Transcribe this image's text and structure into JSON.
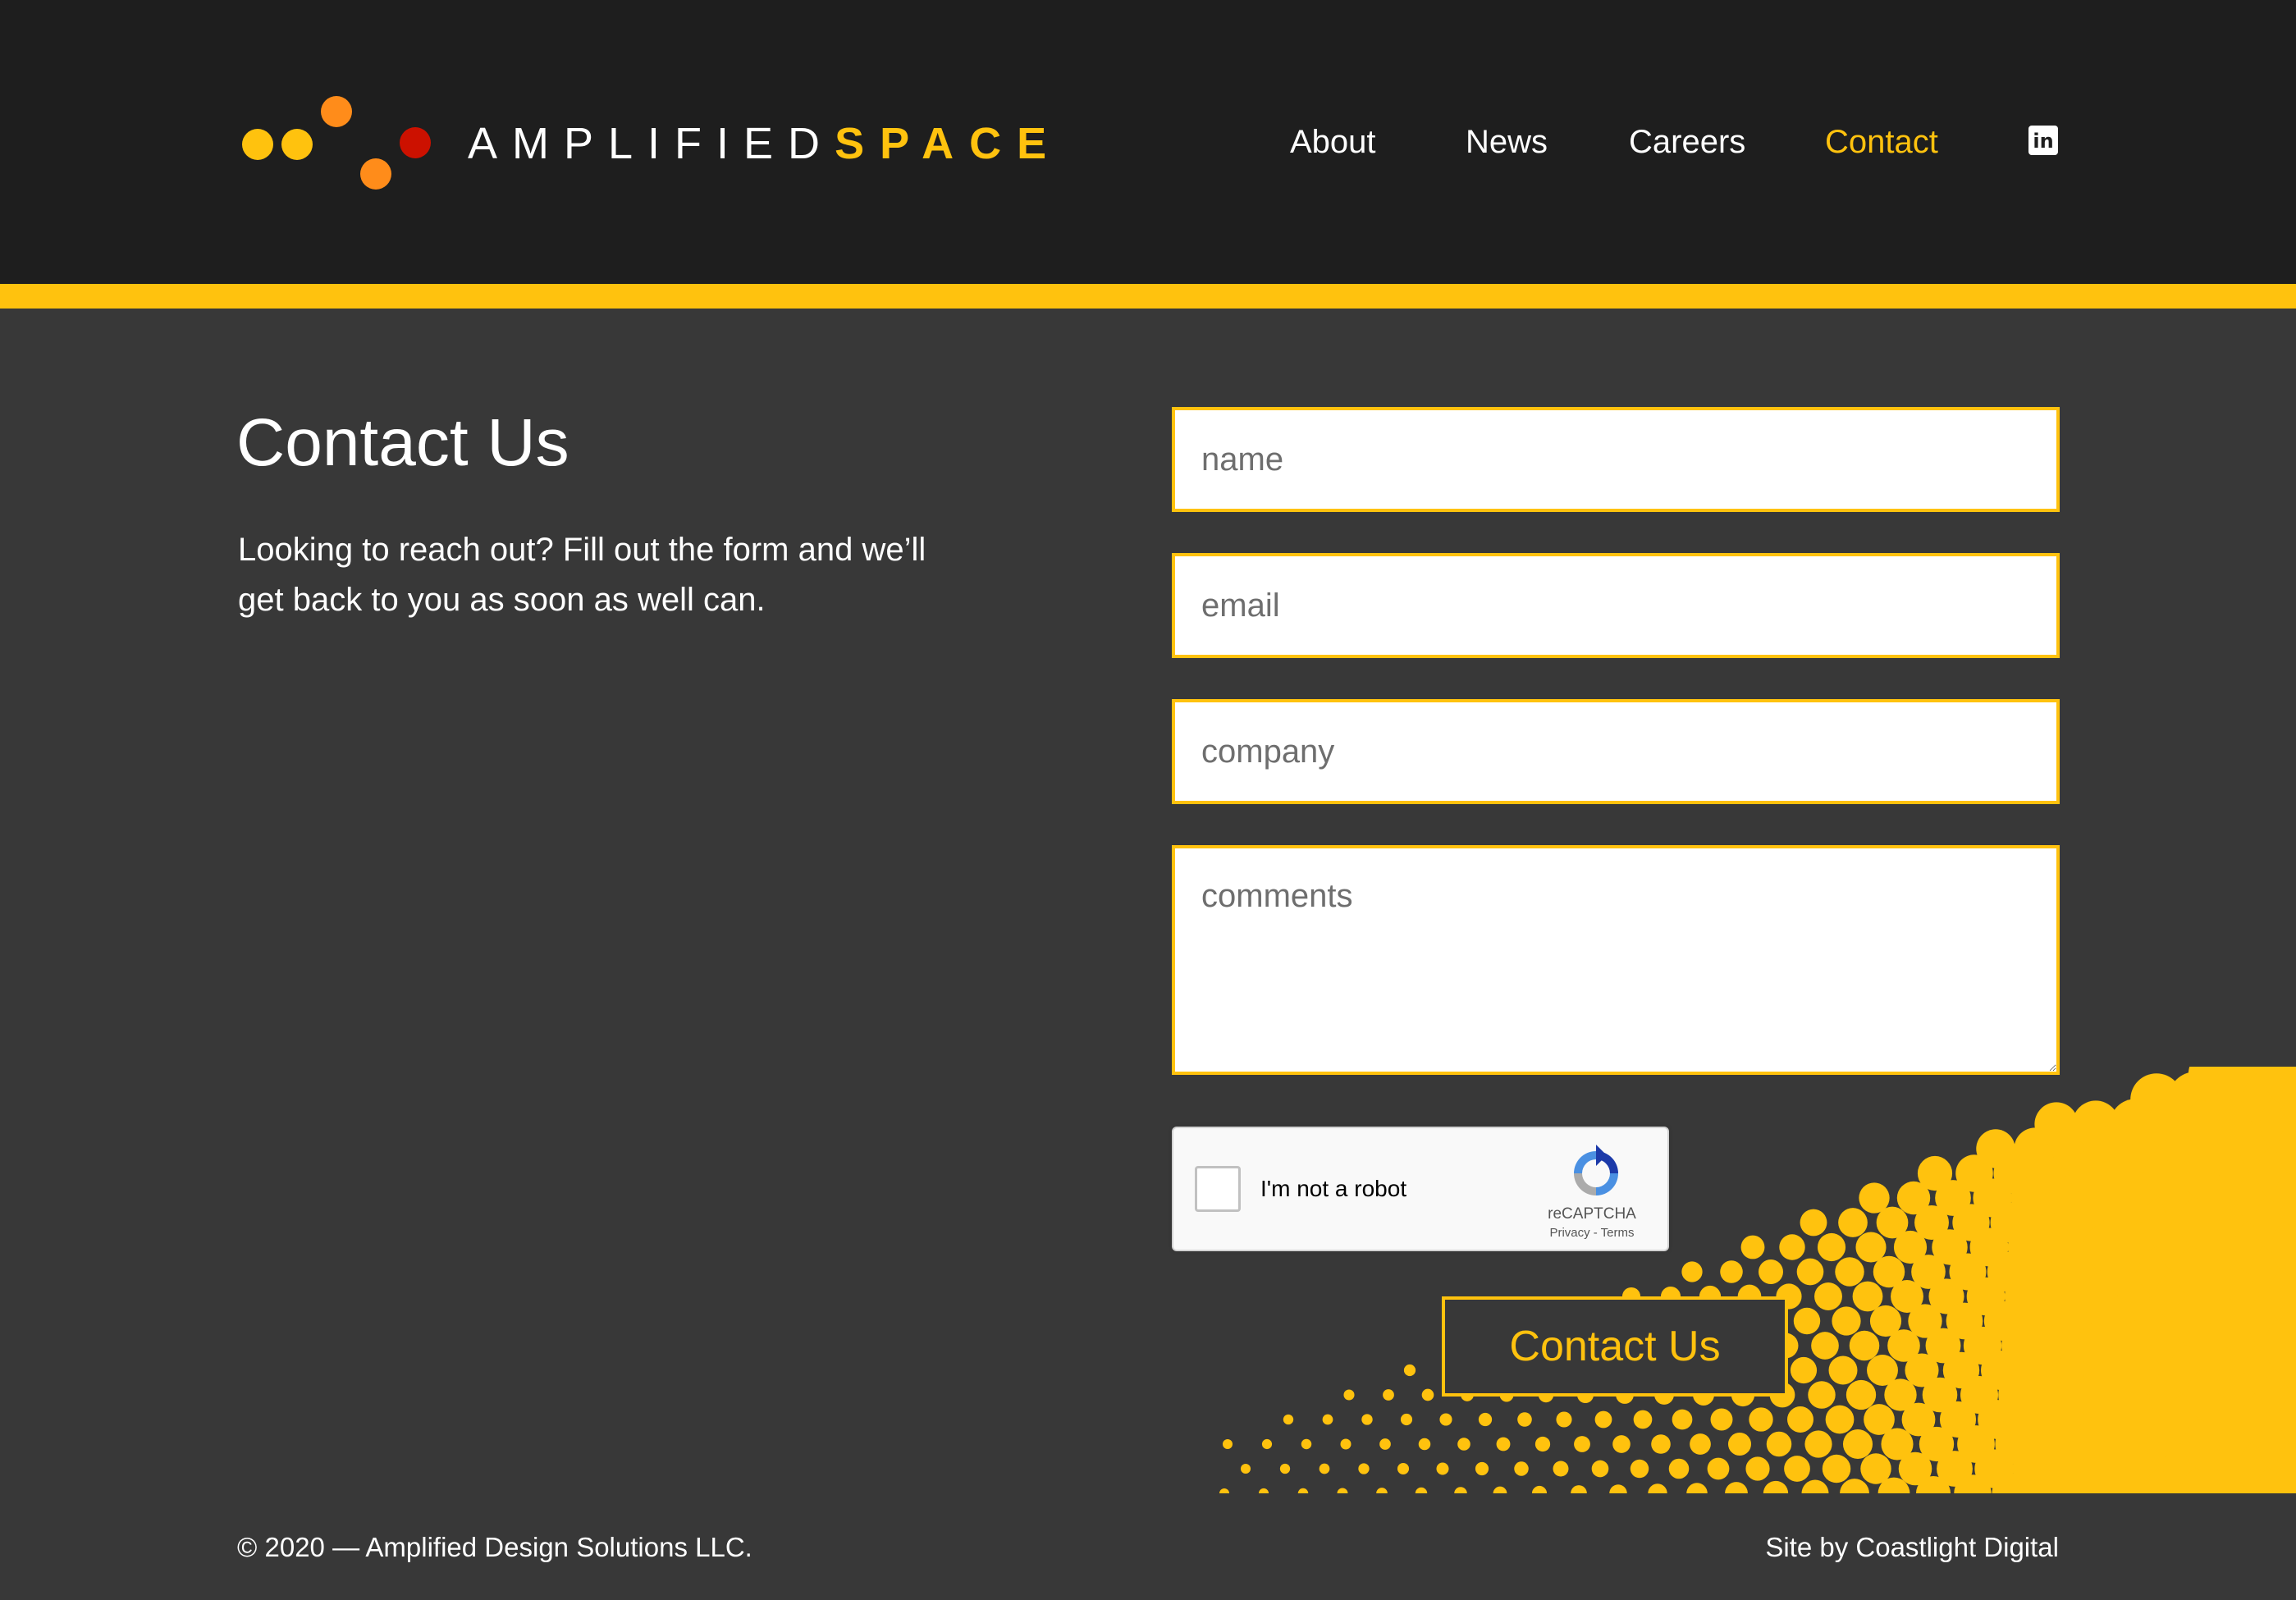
{
  "colors": {
    "accent": "#ffc20e",
    "header_bg": "#1e1e1e",
    "page_bg": "#383838",
    "logo_dot_yellow": "#ffc20e",
    "logo_dot_orange": "#ff8c1a",
    "logo_dot_red": "#cc1100"
  },
  "header": {
    "logo": {
      "word1": "AMPLIFIED",
      "word2": "SPACE"
    },
    "nav": {
      "about": "About",
      "news": "News",
      "careers": "Careers",
      "contact": "Contact",
      "active": "Contact",
      "linkedin_icon": "in"
    }
  },
  "main": {
    "title": "Contact Us",
    "intro": "Looking to reach out? Fill out the form and we’ll get back to you as soon as well can."
  },
  "form": {
    "name_placeholder": "name",
    "email_placeholder": "email",
    "company_placeholder": "company",
    "comments_placeholder": "comments",
    "recaptcha": {
      "label": "I'm not a robot",
      "brand": "reCAPTCHA",
      "links": "Privacy - Terms"
    },
    "submit_label": "Contact Us"
  },
  "footer": {
    "copyright": "© 2020 — Amplified Design Solutions LLC.",
    "credit": "Site by Coastlight Digital"
  }
}
